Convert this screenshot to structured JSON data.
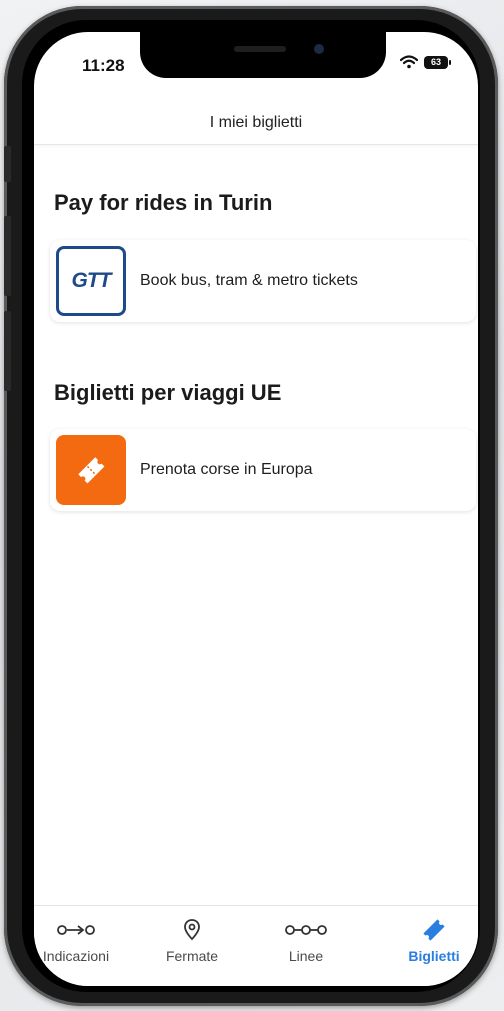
{
  "status": {
    "time": "11:28",
    "battery": "63"
  },
  "header": {
    "title": "I miei biglietti"
  },
  "sections": [
    {
      "title": "Pay for rides in Turin",
      "item": {
        "logo_text": "GTT",
        "label": "Book bus, tram & metro tickets"
      }
    },
    {
      "title": "Biglietti per viaggi UE",
      "item": {
        "label": "Prenota corse in Europa"
      }
    }
  ],
  "tabbar": {
    "tabs": [
      {
        "label": "Indicazioni",
        "icon": "directions-icon"
      },
      {
        "label": "Fermate",
        "icon": "map-pin-icon"
      },
      {
        "label": "Linee",
        "icon": "line-stops-icon"
      },
      {
        "label": "Biglietti",
        "icon": "ticket-icon",
        "active": true
      }
    ]
  },
  "colors": {
    "accent": "#2a7de1",
    "gtt_blue": "#1f4a8a",
    "eu_orange": "#f36a10"
  }
}
